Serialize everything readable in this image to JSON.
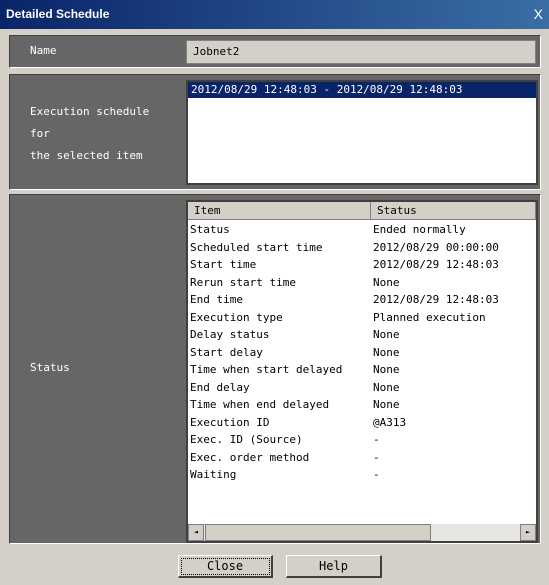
{
  "window": {
    "title": "Detailed Schedule",
    "close_glyph": "X"
  },
  "name_section": {
    "label": "Name",
    "value": "Jobnet2"
  },
  "schedule_section": {
    "label_lines": [
      "Execution schedule",
      "for",
      "the selected item"
    ],
    "items": [
      "2012/08/29 12:48:03 - 2012/08/29 12:48:03"
    ]
  },
  "status_section": {
    "label": "Status",
    "columns": [
      "Item",
      "Status"
    ],
    "rows": [
      [
        "Status",
        "Ended normally"
      ],
      [
        "Scheduled start time",
        "2012/08/29 00:00:00"
      ],
      [
        "Start time",
        "2012/08/29 12:48:03"
      ],
      [
        "Rerun start time",
        "None"
      ],
      [
        "End time",
        "2012/08/29 12:48:03"
      ],
      [
        "Execution type",
        "Planned execution"
      ],
      [
        "Delay status",
        "None"
      ],
      [
        "Start delay",
        "None"
      ],
      [
        "Time when start delayed",
        "None"
      ],
      [
        "End delay",
        "None"
      ],
      [
        "Time when end delayed",
        "None"
      ],
      [
        "Execution ID",
        "@A313"
      ],
      [
        "Exec. ID (Source)",
        "-"
      ],
      [
        "Exec. order method",
        "-"
      ],
      [
        "Waiting",
        "-"
      ]
    ],
    "scroll_left_icon": "◄",
    "scroll_right_icon": "►"
  },
  "buttons": {
    "close_label": "Close",
    "help_label": "Help"
  }
}
